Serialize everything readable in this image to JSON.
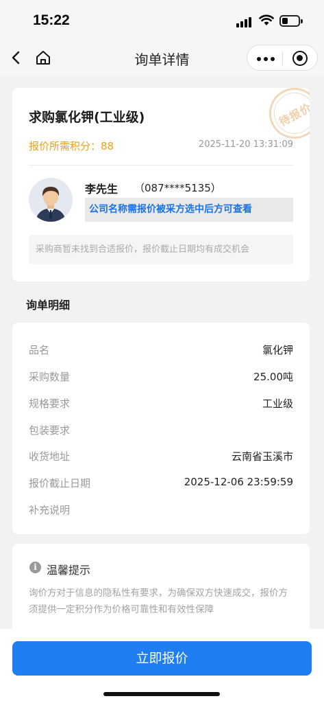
{
  "status_bar": {
    "time": "15:22"
  },
  "nav": {
    "title": "询单详情"
  },
  "inquiry": {
    "title": "求购氯化钾(工业级)",
    "points_label": "报价所需积分：88",
    "date": "2025-11-20 13:31:09",
    "stamp": "待报价",
    "buyer_name": "李先生",
    "buyer_phone": "（087****5135）",
    "company_notice": "公司名称需报价被采方选中后方可查看",
    "hint": "采购商暂未找到合适报价，报价截止日期均有成交机会"
  },
  "details": {
    "section_title": "询单明细",
    "rows": [
      {
        "label": "品名",
        "value": "氯化钾"
      },
      {
        "label": "采购数量",
        "value": "25.00吨"
      },
      {
        "label": "规格要求",
        "value": "工业级"
      },
      {
        "label": "包装要求",
        "value": ""
      },
      {
        "label": "收货地址",
        "value": "云南省玉溪市"
      },
      {
        "label": "报价截止日期",
        "value": "2025-12-06 23:59:59"
      },
      {
        "label": "补充说明",
        "value": ""
      }
    ]
  },
  "tips": {
    "title": "温馨提示",
    "body": "询价方对于信息的隐私性有要求，为确保双方快速成交，报价方须提供一定积分作为价格可靠性和有效性保障"
  },
  "action": {
    "quote_button": "立即报价"
  },
  "colors": {
    "accent": "#1f7ff2",
    "points": "#e8a317",
    "notice": "#1a73e8"
  },
  "icons": [
    "back-arrow-icon",
    "home-icon",
    "more-dots-icon",
    "target-icon",
    "info-icon",
    "wifi-icon",
    "battery-icon",
    "signal-icon"
  ]
}
